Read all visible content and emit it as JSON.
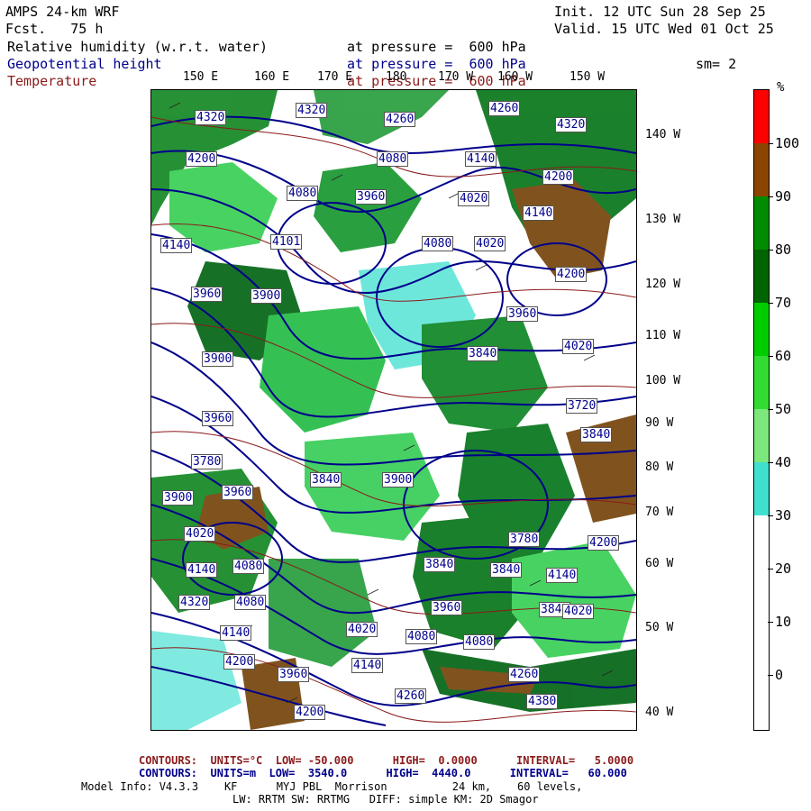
{
  "header": {
    "model": "AMPS 24-km WRF",
    "fcst": "Fcst.   75 h",
    "init": "Init. 12 UTC Sun 28 Sep 25",
    "valid": "Valid. 15 UTC Wed 01 Oct 25",
    "sm": "sm= 2"
  },
  "fields": [
    {
      "name": "Relative humidity (w.r.t. water)",
      "level": "at pressure =  600 hPa",
      "color": "#000000"
    },
    {
      "name": "Geopotential height",
      "level": "at pressure =  600 hPa",
      "color": "#00008b"
    },
    {
      "name": "Temperature",
      "level": "at pressure =  600 hPa",
      "color": "#8b1a1a"
    }
  ],
  "longitude_labels": [
    "150 E",
    "160 E",
    "170 E",
    "180",
    "170 W",
    "160 W",
    "150 W"
  ],
  "latitude_labels": [
    "140 W",
    "130 W",
    "120 W",
    "110 W",
    "100 W",
    "90 W",
    "80 W",
    "70 W",
    "60 W",
    "50 W",
    "40 W"
  ],
  "height_labels": [
    "4320",
    "4320",
    "4260",
    "4320",
    "4260",
    "4200",
    "4080",
    "4080",
    "4140",
    "4200",
    "4020",
    "3960",
    "4140",
    "4200",
    "4140",
    "4080",
    "4101",
    "4020",
    "3900",
    "3960",
    "3960",
    "3900",
    "3840",
    "3960",
    "4020",
    "3720",
    "3840",
    "3900",
    "3780",
    "3960",
    "3840",
    "3900",
    "3840",
    "4020",
    "3780",
    "3840",
    "4140",
    "4080",
    "4140",
    "4320",
    "4080",
    "4200",
    "4140",
    "3840",
    "3960",
    "4080",
    "4020",
    "4080",
    "4260",
    "4140",
    "4020",
    "3960",
    "4200",
    "4260",
    "4200",
    "4380"
  ],
  "colorbar": {
    "unit": "%",
    "labels": [
      "100",
      "90",
      "80",
      "70",
      "60",
      "50",
      "40",
      "30",
      "20",
      "10",
      "0"
    ],
    "segments": [
      {
        "range": "100+",
        "color": "#ff0000"
      },
      {
        "range": "90-100",
        "color": "#8b4500"
      },
      {
        "range": "80-90",
        "color": "#008b00"
      },
      {
        "range": "70-80",
        "color": "#006400"
      },
      {
        "range": "60-70",
        "color": "#00cd00"
      },
      {
        "range": "50-60",
        "color": "#32dc32"
      },
      {
        "range": "40-50",
        "color": "#7ce87c"
      },
      {
        "range": "30-40",
        "color": "#40e0d0"
      },
      {
        "range": "20-30",
        "color": "#ffffff"
      },
      {
        "range": "10-20",
        "color": "#ffffff"
      },
      {
        "range": "0-10",
        "color": "#ffffff"
      }
    ]
  },
  "footer": {
    "temp_contours": "CONTOURS:  UNITS=°C  LOW= -50.000      HIGH=  0.0000      INTERVAL=   5.0000",
    "height_contours": "CONTOURS:  UNITS=m  LOW=  3540.0      HIGH=  4440.0      INTERVAL=   60.000",
    "model_info": "Model Info: V4.3.3    KF      MYJ PBL  Morrison          24 km,    60 levels,",
    "physics": "LW: RRTM SW: RRTMG   DIFF: simple KM: 2D Smagor"
  }
}
